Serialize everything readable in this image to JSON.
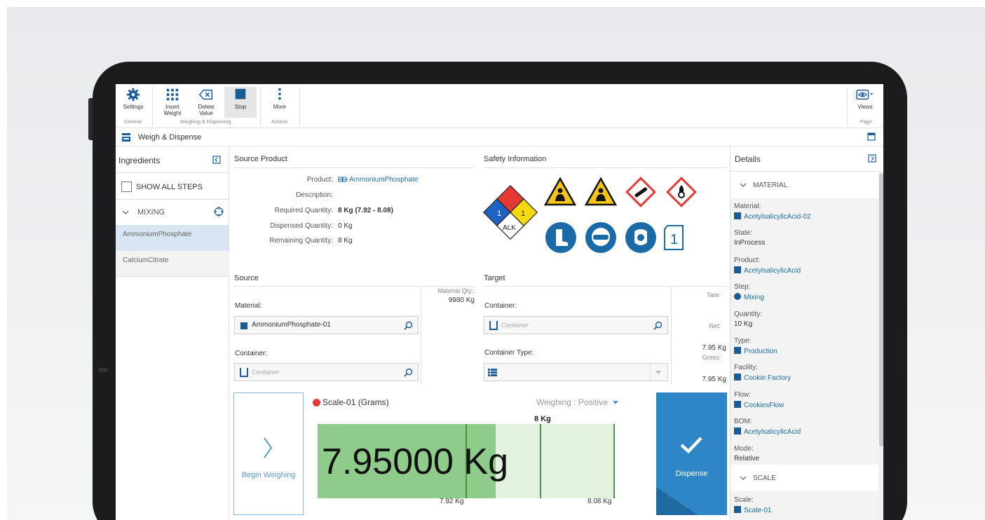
{
  "ribbon": {
    "buttons": {
      "settings": "Settings",
      "insert_weight": "Insert\nWeight",
      "delete_value": "Delete\nValue",
      "stop": "Stop",
      "more": "More",
      "views": "Views"
    },
    "groups": {
      "general": "General",
      "weighing": "Weighing & Dispensing",
      "actions": "Actions",
      "page": "Page"
    }
  },
  "breadcrumb": {
    "title": "Weigh & Dispense"
  },
  "ingredients": {
    "title": "Ingredients",
    "show_all_steps": "SHOW ALL STEPS",
    "group": "MIXING",
    "items": [
      "AmmoniumPhosphate",
      "CalciumCitrate"
    ]
  },
  "source_product": {
    "title": "Source Product",
    "product_label": "Product:",
    "product_value": "AmmoniumPhosphate",
    "description_label": "Description:",
    "required_label": "Required Quantity:",
    "required_value": "8 Kg (7.92 - 8.08)",
    "dispensed_label": "Dispensed Quantity:",
    "dispensed_value": "0 Kg",
    "remaining_label": "Remaining Quantity:",
    "remaining_value": "8 Kg"
  },
  "safety": {
    "title": "Safety Information",
    "nfpa": {
      "health": "1",
      "flammability": "1",
      "special": "ALK"
    },
    "ghs_number": "1"
  },
  "source": {
    "title": "Source",
    "material_label": "Material:",
    "material_value": "AmmoniumPhosphate-01",
    "container_label": "Container:",
    "container_placeholder": "Container",
    "material_qty_label": "Material Qty.:",
    "material_qty_value": "9980 Kg"
  },
  "target": {
    "title": "Target",
    "container_label": "Container:",
    "container_placeholder": "Container",
    "container_type_label": "Container Type:",
    "tare_label": "Tare:",
    "net_label": "Net:",
    "net_value": "7.95 Kg",
    "gross_label": "Gross:",
    "gross_value": "7.95 Kg"
  },
  "scale": {
    "name": "Scale-01 (Grams)",
    "mode": "Weighing : Positive",
    "reading": "7.95000 Kg",
    "target": "8 Kg",
    "min": "7.92 Kg",
    "max": "8.08 Kg",
    "fill_fraction": 0.6,
    "begin_label": "Begin Weighing",
    "dispense_label": "Dispense",
    "status_color": "#e53935"
  },
  "details": {
    "title": "Details",
    "material_section": "MATERIAL",
    "scale_section": "SCALE",
    "fields": [
      {
        "key": "Material:",
        "value": "AcetylsalicylicAcid-02",
        "icon": "square-icon"
      },
      {
        "key": "State:",
        "value": "InProcess",
        "icon": ""
      },
      {
        "key": "Product:",
        "value": "AcetylsalicylicAcid",
        "icon": "product-icon"
      },
      {
        "key": "Step:",
        "value": "Mixing",
        "icon": "circle-icon"
      },
      {
        "key": "Quantity:",
        "value": "10 Kg",
        "icon": ""
      },
      {
        "key": "Type:",
        "value": "Production",
        "icon": "list-icon"
      },
      {
        "key": "Facility:",
        "value": "Cookie Factory",
        "icon": "factory-icon"
      },
      {
        "key": "Flow:",
        "value": "CookiesFlow",
        "icon": "flow-icon"
      },
      {
        "key": "BOM:",
        "value": "AcetylsalicylicAcid",
        "icon": "bom-icon"
      },
      {
        "key": "Mode:",
        "value": "Relative",
        "icon": ""
      }
    ],
    "scale_key": "Scale:",
    "scale_value": "Scale-01"
  },
  "colors": {
    "accent": "#1a6ea8",
    "dispense": "#2f86c6",
    "bar_fill": "#8fcc8b",
    "bar_track": "#e2f2df"
  }
}
